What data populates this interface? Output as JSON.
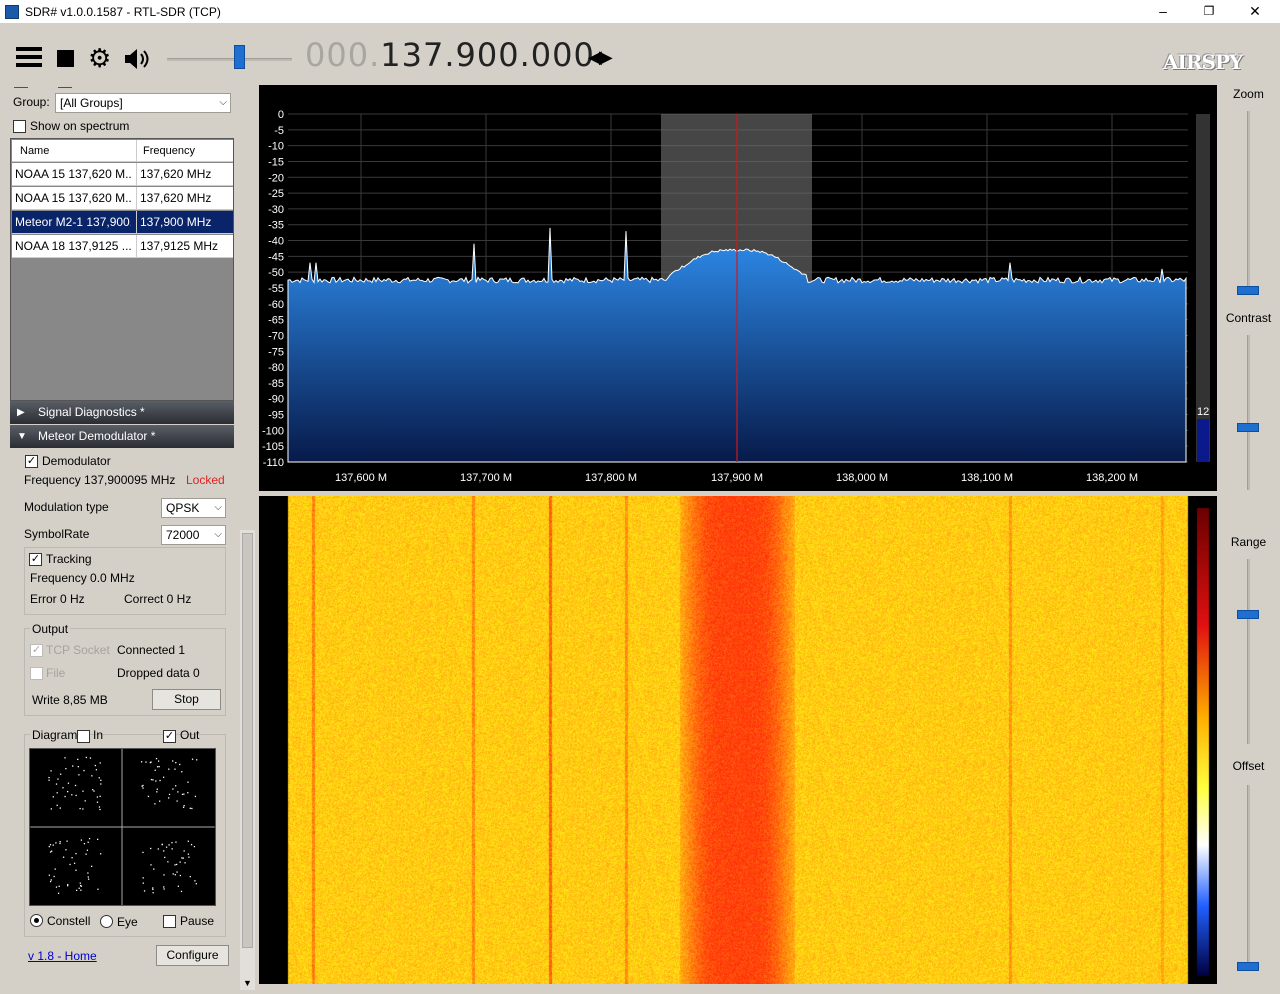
{
  "window": {
    "title": "SDR# v1.0.0.1587 - RTL-SDR (TCP)",
    "minimize": "–",
    "maximize": "❐",
    "close": "✕"
  },
  "toolbar": {
    "frequency_dim": "000.",
    "frequency_main": "137.900.000",
    "logo": "AIRSPY",
    "tune_arrows": "◀▶"
  },
  "frequency_manager": {
    "group_label": "Group:",
    "group_value": "[All Groups]",
    "show_on_spectrum": "Show on spectrum",
    "columns": [
      "Name",
      "Frequency"
    ],
    "rows": [
      {
        "name": "NOAA 15 137,620 M...",
        "freq": "137,620 MHz"
      },
      {
        "name": "NOAA 15 137,620 M...",
        "freq": "137,620 MHz"
      },
      {
        "name": "Meteor M2-1 137,900...",
        "freq": "137,900 MHz"
      },
      {
        "name": "NOAA 18 137,9125 ...",
        "freq": "137,9125 MHz"
      }
    ]
  },
  "sections": {
    "signal_diagnostics": "Signal Diagnostics *",
    "meteor_demodulator": "Meteor Demodulator *"
  },
  "demod": {
    "demodulator": "Demodulator",
    "frequency": "Frequency 137,900095 MHz",
    "locked": "Locked",
    "modulation_label": "Modulation type",
    "modulation_value": "QPSK",
    "symbolrate_label": "SymbolRate",
    "symbolrate_value": "72000",
    "tracking": "Tracking",
    "tracking_freq": "Frequency 0.0 MHz",
    "error": "Error 0 Hz",
    "correct": "Correct 0 Hz",
    "output_label": "Output",
    "tcp_socket": "TCP Socket",
    "connected": "Connected 1",
    "file": "File",
    "dropped": "Dropped data 0",
    "write": "Write 8,85 MB",
    "stop": "Stop",
    "diagram": "Diagram",
    "in": "In",
    "out": "Out",
    "constell": "Constell",
    "eye": "Eye",
    "pause": "Pause",
    "home_link": "v 1.8 - Home",
    "configure": "Configure"
  },
  "right_panel": {
    "zoom": "Zoom",
    "contrast": "Contrast",
    "range": "Range",
    "offset": "Offset"
  },
  "spectrum": {
    "scale_value": "12",
    "y_ticks": [
      "0",
      "-5",
      "-10",
      "-15",
      "-20",
      "-25",
      "-30",
      "-35",
      "-40",
      "-45",
      "-50",
      "-55",
      "-60",
      "-65",
      "-70",
      "-75",
      "-80",
      "-85",
      "-90",
      "-95",
      "-100",
      "-105",
      "-110"
    ],
    "x_ticks": [
      "137,600 M",
      "137,700 M",
      "137,800 M",
      "137,900 M",
      "138,000 M",
      "138,100 M",
      "138,200 M"
    ],
    "colors": {
      "fill_top": "#2f8ff0",
      "fill_bottom": "#071a4a",
      "band": "#6b6b6b",
      "center": "#d01818"
    }
  }
}
